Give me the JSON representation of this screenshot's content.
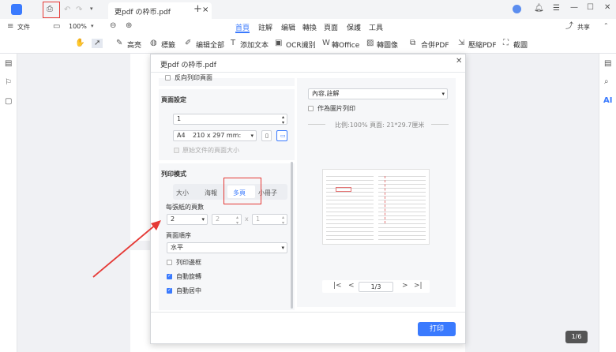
{
  "window": {
    "tab_title": "更pdf の枠币.pdf",
    "tab_close": "×",
    "new_tab": "+"
  },
  "menu": {
    "file_label": "文件",
    "zoom": "100%",
    "tabs": [
      "首頁",
      "註解",
      "编辑",
      "轉換",
      "頁面",
      "保護",
      "工具"
    ],
    "share": "共享"
  },
  "toolbar": {
    "items": [
      "高亮",
      "標籤",
      "编辑全部",
      "添加文本",
      "OCR識別",
      "轉Office",
      "轉圖像",
      "合併PDF",
      "壓縮PDF",
      "截圖"
    ]
  },
  "dialog": {
    "title": "更pdf の枠币.pdf",
    "top_partial": "反向列印頁面",
    "page_settings_label": "頁面設定",
    "copies": "1",
    "paper_size": "A4",
    "paper_dim": "210 x 297 mm:",
    "original_size": "原始文件的頁面大小",
    "print_mode_label": "列印模式",
    "mode_tabs": [
      "大小",
      "海報",
      "多頁",
      "小冊子"
    ],
    "pages_per_sheet_label": "每張紙的頁數",
    "pages_per_sheet": "2",
    "grid_cols": "2",
    "grid_x": "x",
    "grid_rows": "1",
    "page_order_label": "頁面順序",
    "page_order": "水平",
    "print_border": "列印邊框",
    "auto_rotate": "自動旋轉",
    "auto_center": "自動居中",
    "content_select": "內容,註解",
    "print_as_image": "作為圖片列印",
    "scale_info": "比例:100%  頁面: 21*29.7厘米",
    "page_indicator": "1/3",
    "print_button": "打印"
  },
  "page_counter": "1/6",
  "colors": {
    "accent": "#3a7afe",
    "highlight_box": "#e53935",
    "arrow": "#e53935"
  }
}
